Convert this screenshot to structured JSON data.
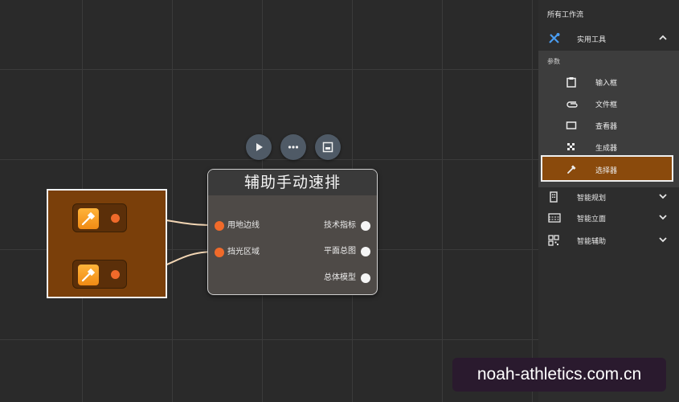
{
  "node": {
    "title": "辅助手动速排",
    "inputs": [
      "用地边线",
      "挡光区域"
    ],
    "outputs": [
      "技术指标",
      "平面总图",
      "总体模型"
    ]
  },
  "toolbar": {
    "icons": [
      "play-icon",
      "more-icon",
      "panel-icon"
    ]
  },
  "sidebar": {
    "title": "所有工作流",
    "expanded_category": {
      "label": "实用工具",
      "icon": "tools-icon"
    },
    "params_label": "参数",
    "items": [
      {
        "label": "输入框",
        "icon": "clipboard-icon"
      },
      {
        "label": "文件框",
        "icon": "paperclip-icon"
      },
      {
        "label": "查看器",
        "icon": "viewer-icon"
      },
      {
        "label": "生成器",
        "icon": "generator-icon"
      },
      {
        "label": "选择器",
        "icon": "eyedropper-icon",
        "selected": true
      }
    ],
    "categories": [
      {
        "label": "智能规划",
        "icon": "building-icon"
      },
      {
        "label": "智能立面",
        "icon": "facade-icon"
      },
      {
        "label": "智能辅助",
        "icon": "grid-icon"
      }
    ]
  },
  "watermark": "noah-athletics.com.cn",
  "colors": {
    "accent_orange": "#f06a2a",
    "selected_bg": "#8a4a0c",
    "group_bg": "#7a3f0a",
    "canvas_bg": "#2a2a2a"
  }
}
